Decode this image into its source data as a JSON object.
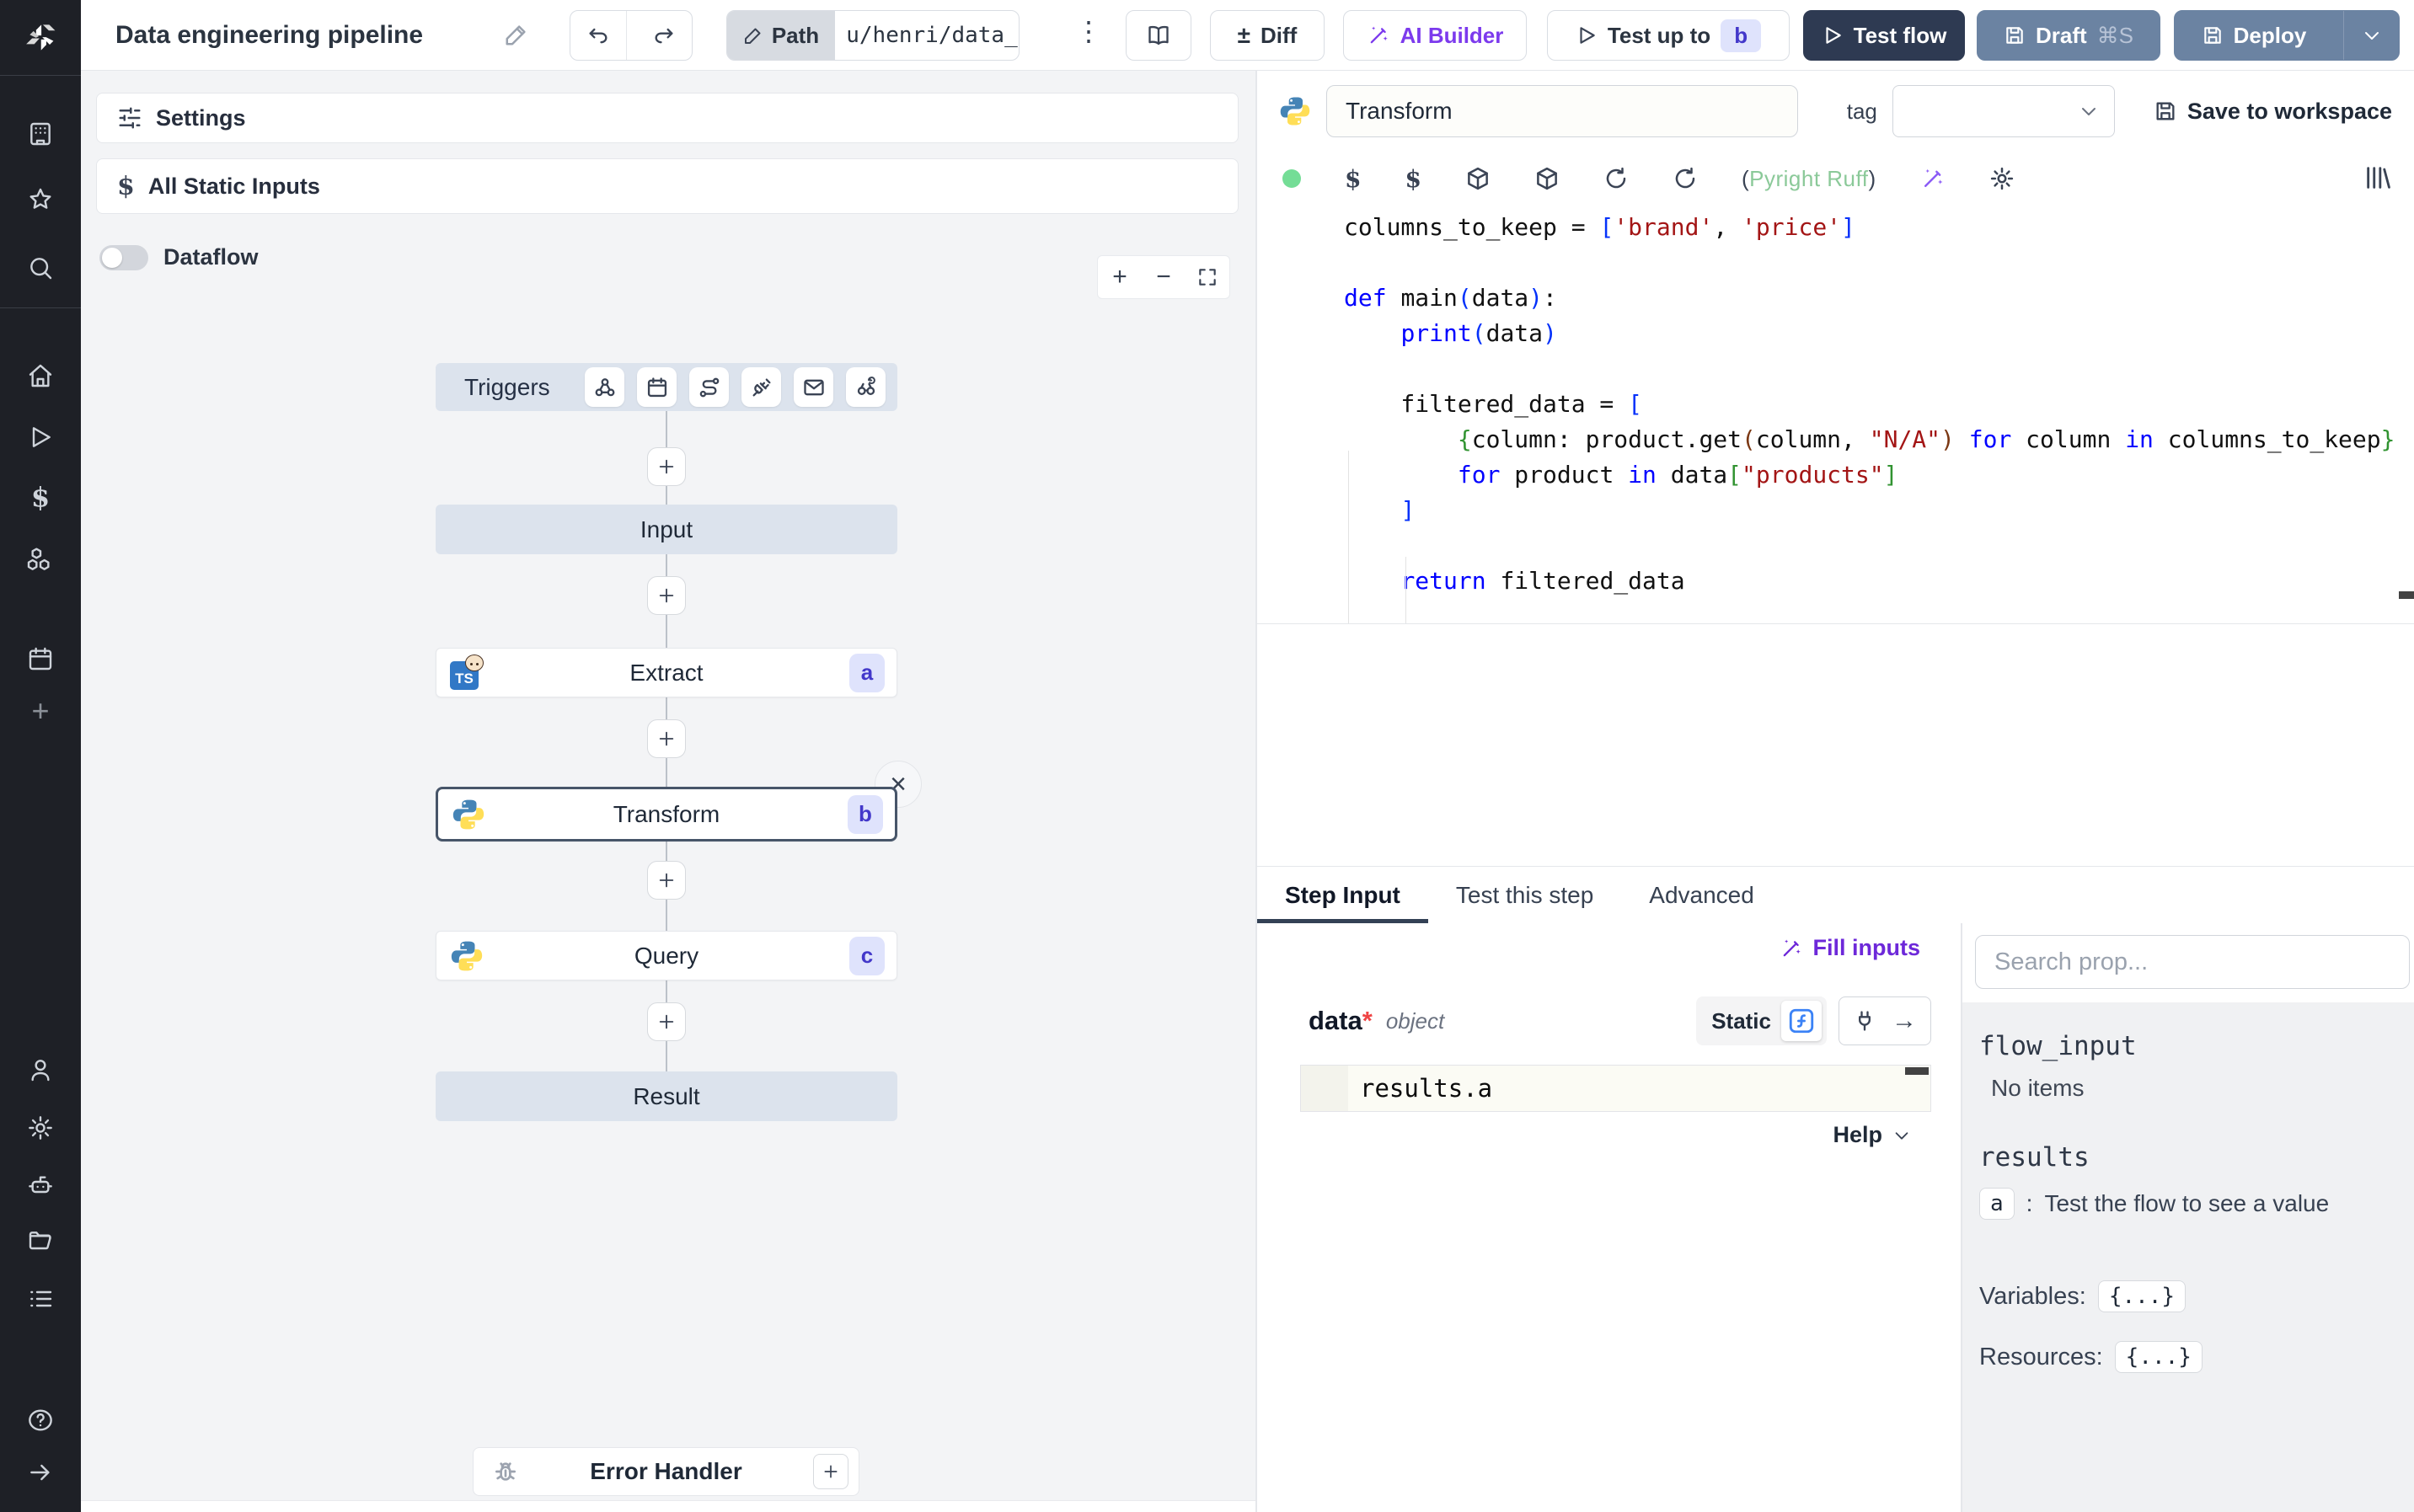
{
  "topbar": {
    "title": "Data engineering pipeline",
    "path_label": "Path",
    "path_value": "u/henri/data_",
    "diff_label": "Diff",
    "ai_builder_label": "AI Builder",
    "test_up_to_label": "Test up to",
    "test_up_to_badge": "b",
    "test_flow_label": "Test flow",
    "draft_label": "Draft",
    "draft_shortcut": "⌘S",
    "deploy_label": "Deploy"
  },
  "flow": {
    "settings_label": "Settings",
    "all_static_inputs_label": "All Static Inputs",
    "dataflow_label": "Dataflow",
    "triggers_label": "Triggers",
    "input_label": "Input",
    "result_label": "Result",
    "error_handler_label": "Error Handler",
    "nodes": [
      {
        "label": "Extract",
        "badge": "a",
        "language": "bun-typescript"
      },
      {
        "label": "Transform",
        "badge": "b",
        "language": "python",
        "selected": true
      },
      {
        "label": "Query",
        "badge": "c",
        "language": "python"
      }
    ]
  },
  "editor": {
    "step_name": "Transform",
    "tag_label": "tag",
    "save_to_workspace_label": "Save to workspace",
    "lint_open": "(",
    "lint_text": "Pyright Ruff",
    "lint_close": ")",
    "code_lines": [
      [
        {
          "t": "columns_to_keep = ",
          "c": "p"
        },
        {
          "t": "[",
          "c": "b1"
        },
        {
          "t": "'brand'",
          "c": "s"
        },
        {
          "t": ", ",
          "c": "p"
        },
        {
          "t": "'price'",
          "c": "s"
        },
        {
          "t": "]",
          "c": "b1"
        }
      ],
      [],
      [
        {
          "t": "def ",
          "c": "k"
        },
        {
          "t": "main",
          "c": "p"
        },
        {
          "t": "(",
          "c": "b1"
        },
        {
          "t": "data",
          "c": "p"
        },
        {
          "t": ")",
          "c": "b1"
        },
        {
          "t": ":",
          "c": "p"
        }
      ],
      [
        {
          "t": "    ",
          "c": "p"
        },
        {
          "t": "print",
          "c": "k"
        },
        {
          "t": "(",
          "c": "b1"
        },
        {
          "t": "data",
          "c": "p"
        },
        {
          "t": ")",
          "c": "b1"
        }
      ],
      [],
      [
        {
          "t": "    filtered_data = ",
          "c": "p"
        },
        {
          "t": "[",
          "c": "b1"
        }
      ],
      [
        {
          "t": "        ",
          "c": "p"
        },
        {
          "t": "{",
          "c": "b2"
        },
        {
          "t": "column: product.get",
          "c": "p"
        },
        {
          "t": "(",
          "c": "b3"
        },
        {
          "t": "column, ",
          "c": "p"
        },
        {
          "t": "\"N/A\"",
          "c": "s"
        },
        {
          "t": ")",
          "c": "b3"
        },
        {
          "t": " ",
          "c": "p"
        },
        {
          "t": "for",
          "c": "k"
        },
        {
          "t": " column ",
          "c": "p"
        },
        {
          "t": "in",
          "c": "k"
        },
        {
          "t": " columns_to_keep",
          "c": "p"
        },
        {
          "t": "}",
          "c": "b2"
        }
      ],
      [
        {
          "t": "        ",
          "c": "p"
        },
        {
          "t": "for",
          "c": "k"
        },
        {
          "t": " product ",
          "c": "p"
        },
        {
          "t": "in",
          "c": "k"
        },
        {
          "t": " data",
          "c": "p"
        },
        {
          "t": "[",
          "c": "b2"
        },
        {
          "t": "\"products\"",
          "c": "s"
        },
        {
          "t": "]",
          "c": "b2"
        }
      ],
      [
        {
          "t": "    ",
          "c": "p"
        },
        {
          "t": "]",
          "c": "b1"
        }
      ],
      [],
      [
        {
          "t": "    ",
          "c": "p"
        },
        {
          "t": "return",
          "c": "k"
        },
        {
          "t": " filtered_data",
          "c": "p"
        }
      ]
    ]
  },
  "tabs": {
    "step_input": "Step Input",
    "test_this_step": "Test this step",
    "advanced": "Advanced"
  },
  "step_input": {
    "fill_inputs_label": "Fill inputs",
    "field_name": "data",
    "required_mark": "*",
    "field_type": "object",
    "static_label": "Static",
    "expression": "results.a",
    "help_label": "Help"
  },
  "props": {
    "search_placeholder": "Search prop...",
    "flow_input_label": "flow_input",
    "flow_input_empty": "No items",
    "results_label": "results",
    "result_key": "a",
    "result_sep": ":",
    "result_hint": "Test the flow to see a value",
    "variables_label": "Variables:",
    "variables_value": "{...}",
    "resources_label": "Resources:",
    "resources_value": "{...}"
  },
  "glyphs": {
    "kebab": "⋮",
    "diff": "±",
    "close": "×",
    "fn": "ƒ",
    "arrow_right": "→",
    "dollar": "$",
    "plus": "+",
    "minus": "−"
  },
  "colors": {
    "accent_purple": "#7c3aed",
    "navy_button": "#2e3a52",
    "slate_button": "#6b83a2",
    "badge_bg": "#dfe3fc",
    "badge_text": "#4338ca",
    "node_bluegray": "#dce3ed",
    "lint_green": "#8bc999",
    "selected_border": "#475569"
  }
}
